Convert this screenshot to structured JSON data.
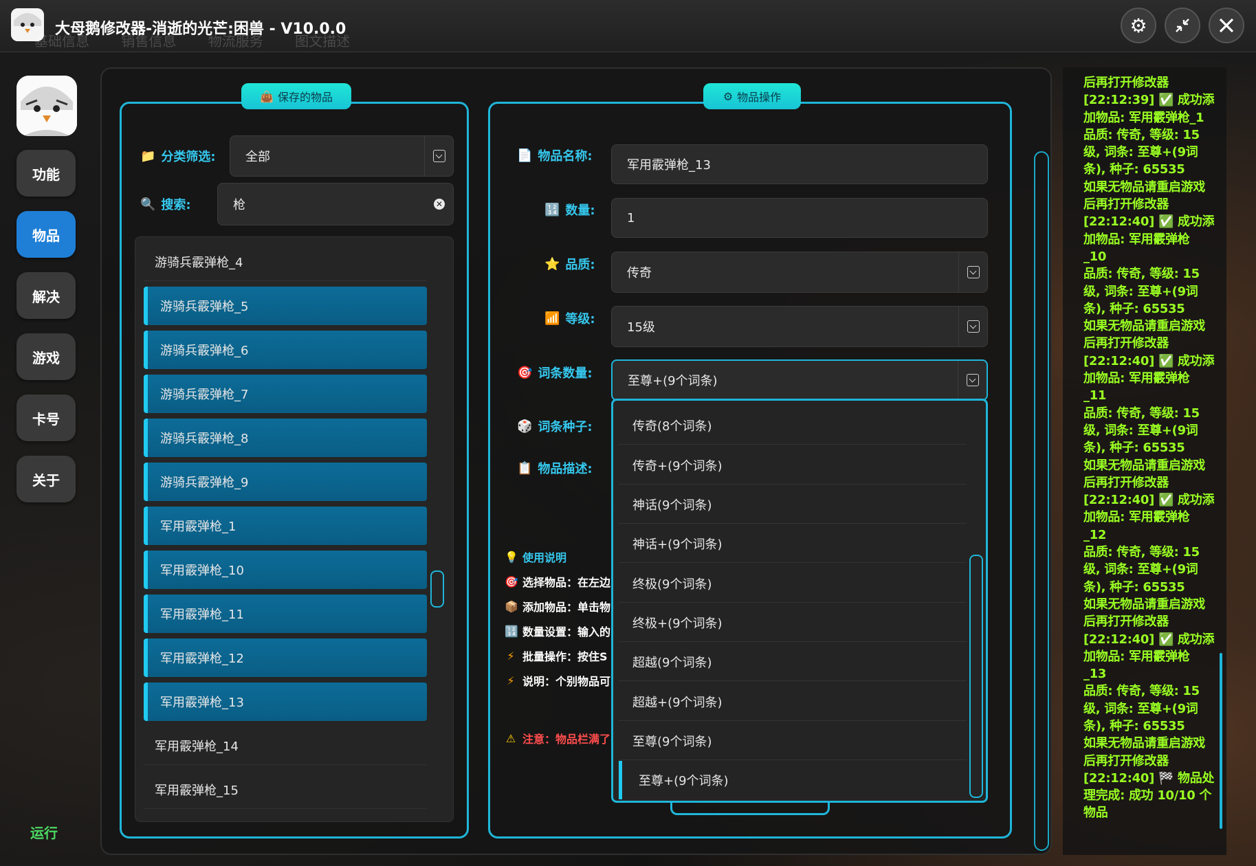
{
  "window": {
    "title": "大母鹅修改器-消逝的光芒:困兽 - V10.0.0",
    "ghost_tabs": [
      "基础信息",
      "销售信息",
      "物流服务",
      "图文描述"
    ]
  },
  "sidebar": {
    "items": [
      {
        "label": "功能",
        "active": false
      },
      {
        "label": "物品",
        "active": true
      },
      {
        "label": "解决",
        "active": false
      },
      {
        "label": "游戏",
        "active": false
      },
      {
        "label": "卡号",
        "active": false
      },
      {
        "label": "关于",
        "active": false
      }
    ],
    "status": "运行"
  },
  "saved_items": {
    "tab_label": "保存的物品",
    "filter_label": "分类筛选:",
    "filter_value": "全部",
    "search_label": "搜索:",
    "search_value": "枪",
    "items": [
      {
        "label": "游骑兵霰弹枪_4",
        "selected": false
      },
      {
        "label": "游骑兵霰弹枪_5",
        "selected": true
      },
      {
        "label": "游骑兵霰弹枪_6",
        "selected": true
      },
      {
        "label": "游骑兵霰弹枪_7",
        "selected": true
      },
      {
        "label": "游骑兵霰弹枪_8",
        "selected": true
      },
      {
        "label": "游骑兵霰弹枪_9",
        "selected": true
      },
      {
        "label": "军用霰弹枪_1",
        "selected": true
      },
      {
        "label": "军用霰弹枪_10",
        "selected": true
      },
      {
        "label": "军用霰弹枪_11",
        "selected": true
      },
      {
        "label": "军用霰弹枪_12",
        "selected": true
      },
      {
        "label": "军用霰弹枪_13",
        "selected": true
      },
      {
        "label": "军用霰弹枪_14",
        "selected": false
      },
      {
        "label": "军用霰弹枪_15",
        "selected": false
      }
    ]
  },
  "item_ops": {
    "tab_label": "物品操作",
    "fields": {
      "name_label": "物品名称:",
      "name_value": "军用霰弹枪_13",
      "qty_label": "数量:",
      "qty_value": "1",
      "quality_label": "品质:",
      "quality_value": "传奇",
      "level_label": "等级:",
      "level_value": "15级",
      "affix_count_label": "词条数量:",
      "affix_count_value": "至尊+(9个词条)",
      "affix_seed_label": "词条种子:",
      "desc_label": "物品描述:"
    },
    "affix_options": [
      "传奇(8个词条)",
      "传奇+(9个词条)",
      "神话(9个词条)",
      "神话+(9个词条)",
      "终极(9个词条)",
      "终极+(9个词条)",
      "超越(9个词条)",
      "超越+(9个词条)",
      "至尊(9个词条)",
      "至尊+(9个词条)"
    ],
    "help": {
      "title": "使用说明",
      "lines": [
        "选择物品：在左边",
        "添加物品：单击物",
        "数量设置：输入的",
        "批量操作：按住S",
        "说明：个别物品可"
      ],
      "warning": "注意：物品栏满了"
    }
  },
  "log": {
    "text": "后再打开修改器\n[22:12:39] ✅ 成功添\n加物品: 军用霰弹枪_1\n品质: 传奇, 等级: 15\n级, 词条: 至尊+(9词\n条), 种子: 65535\n如果无物品请重启游戏\n后再打开修改器\n[22:12:40] ✅ 成功添\n加物品: 军用霰弹枪\n_10\n品质: 传奇, 等级: 15\n级, 词条: 至尊+(9词\n条), 种子: 65535\n如果无物品请重启游戏\n后再打开修改器\n[22:12:40] ✅ 成功添\n加物品: 军用霰弹枪\n_11\n品质: 传奇, 等级: 15\n级, 词条: 至尊+(9词\n条), 种子: 65535\n如果无物品请重启游戏\n后再打开修改器\n[22:12:40] ✅ 成功添\n加物品: 军用霰弹枪\n_12\n品质: 传奇, 等级: 15\n级, 词条: 至尊+(9词\n条), 种子: 65535\n如果无物品请重启游戏\n后再打开修改器\n[22:12:40] ✅ 成功添\n加物品: 军用霰弹枪\n_13\n品质: 传奇, 等级: 15\n级, 词条: 至尊+(9词\n条), 种子: 65535\n如果无物品请重启游戏\n后再打开修改器\n[22:12:40] 🏁 物品处\n理完成: 成功 10/10 个\n物品"
  },
  "colors": {
    "accent": "#1fb6d9",
    "tab_bg": "#1fe6d6",
    "nav_active": "#1f7fd6",
    "log_text": "#9aff22",
    "run": "#4cd964"
  }
}
